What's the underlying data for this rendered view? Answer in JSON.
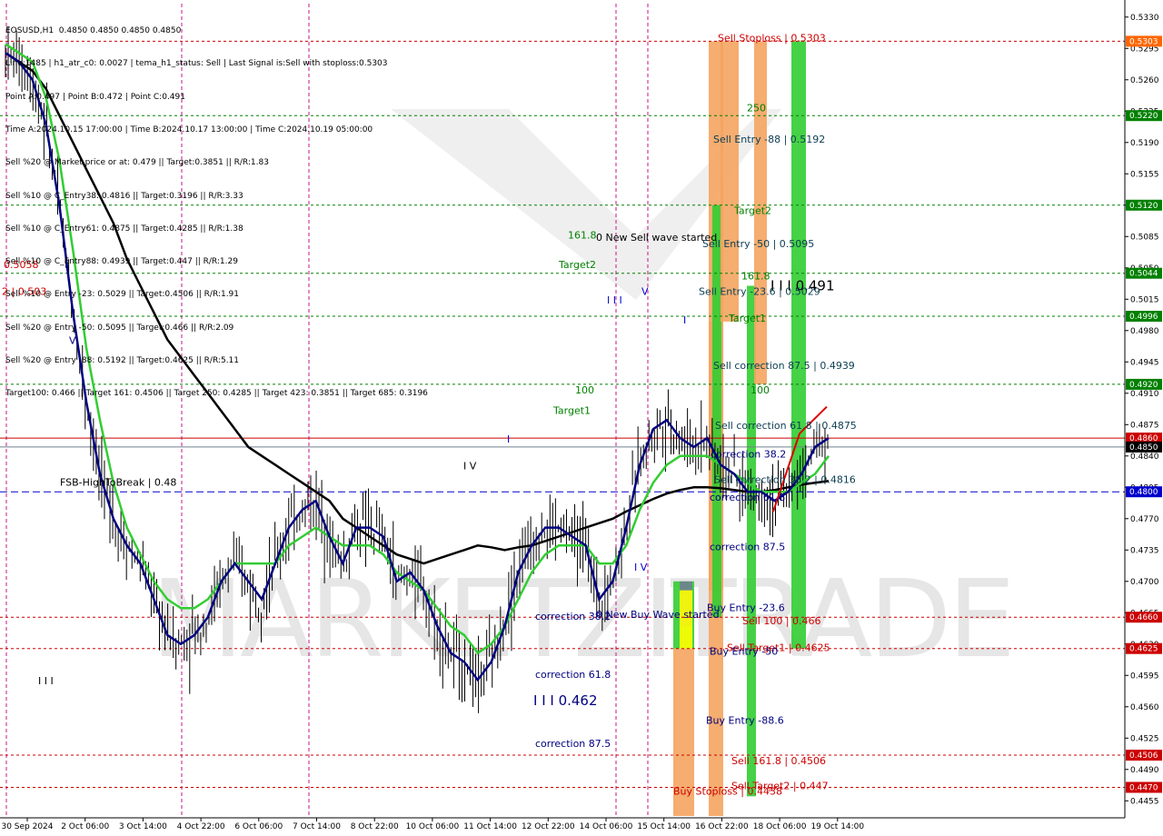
{
  "header": {
    "lines": [
      "EOSUSD,H1  0.4850 0.4850 0.4850 0.4850",
      "Line:1485 | h1_atr_c0: 0.0027 | tema_h1_status: Sell | Last Signal is:Sell with stoploss:0.5303",
      "Point A:0.497 | Point B:0.472 | Point C:0.491",
      "Time A:2024.10.15 17:00:00 | Time B:2024.10.17 13:00:00 | Time C:2024.10.19 05:00:00",
      "Sell %20 @ Market price or at: 0.479 || Target:0.3851 || R/R:1.83",
      "Sell %10 @ C_Entry38: 0.4816 || Target:0.3196 || R/R:3.33",
      "Sell %10 @ C_Entry61: 0.4875 || Target:0.4285 || R/R:1.38",
      "Sell %10 @ C_Entry88: 0.4939 || Target:0.447 || R/R:1.29",
      "Sell %10 @ Entry -23: 0.5029 || Target:0.4506 || R/R:1.91",
      "Sell %20 @ Entry -50: 0.5095 || Target:0.466 || R/R:2.09",
      "Sell %20 @ Entry -88: 0.5192 || Target:0.4625 || R/R:5.11",
      "Target100: 0.466 || Target 161: 0.4506 || Target 250: 0.4285 || Target 423: 0.3851 || Target 685: 0.3196"
    ]
  },
  "colors": {
    "background": "#ffffff",
    "bull_candle": "#000000",
    "bear_candle": "#000000",
    "ema_blue": "#000080",
    "ema_green": "#32cd32",
    "ma_black": "#000000",
    "orange_band": "#ff6600",
    "level_red": "#cc0000",
    "level_green": "#008000",
    "level_blue": "#0000cc",
    "bar_orange": "#f4a460",
    "bar_green": "#32cd32",
    "bar_yellow": "#ffff00",
    "bar_gray": "#708090",
    "watermark": "#e6e6e6"
  },
  "chart_data": {
    "type": "candlestick",
    "symbol": "EOSUSD",
    "timeframe": "H1",
    "ylim": [
      0.4436,
      0.5345
    ],
    "y_ticks": [
      "0.5330",
      "0.5295",
      "0.5260",
      "0.5225",
      "0.5190",
      "0.5155",
      "0.5120",
      "0.5085",
      "0.5050",
      "0.5015",
      "0.4980",
      "0.4945",
      "0.4910",
      "0.4875",
      "0.4840",
      "0.4805",
      "0.4770",
      "0.4735",
      "0.4700",
      "0.4665",
      "0.4630",
      "0.4595",
      "0.4560",
      "0.4525",
      "0.4490",
      "0.4455"
    ],
    "x_ticks": [
      "30 Sep 2024",
      "2 Oct 06:00",
      "3 Oct 14:00",
      "4 Oct 22:00",
      "6 Oct 06:00",
      "7 Oct 14:00",
      "8 Oct 22:00",
      "10 Oct 06:00",
      "11 Oct 14:00",
      "12 Oct 22:00",
      "14 Oct 06:00",
      "15 Oct 14:00",
      "16 Oct 22:00",
      "18 Oct 06:00",
      "19 Oct 14:00"
    ],
    "price_tags": [
      {
        "value": 0.5303,
        "label": "0.5303",
        "color": "#ff6600"
      },
      {
        "value": 0.522,
        "label": "0.5220",
        "color": "#008000"
      },
      {
        "value": 0.512,
        "label": "0.5120",
        "color": "#008000"
      },
      {
        "value": 0.5044,
        "label": "0.5044",
        "color": "#008000"
      },
      {
        "value": 0.4996,
        "label": "0.4996",
        "color": "#008000"
      },
      {
        "value": 0.492,
        "label": "0.4920",
        "color": "#008000"
      },
      {
        "value": 0.486,
        "label": "0.4860",
        "color": "#cc0000"
      },
      {
        "value": 0.485,
        "label": "0.4850",
        "color": "#000000"
      },
      {
        "value": 0.48,
        "label": "0.4800",
        "color": "#0000cc"
      },
      {
        "value": 0.466,
        "label": "0.4660",
        "color": "#cc0000"
      },
      {
        "value": 0.4625,
        "label": "0.4625",
        "color": "#cc0000"
      },
      {
        "value": 0.4506,
        "label": "0.4506",
        "color": "#cc0000"
      },
      {
        "value": 0.447,
        "label": "0.4470",
        "color": "#cc0000"
      }
    ],
    "ema_fast": [
      0.529,
      0.528,
      0.526,
      0.521,
      0.512,
      0.5,
      0.49,
      0.482,
      0.477,
      0.474,
      0.472,
      0.468,
      0.464,
      0.463,
      0.464,
      0.466,
      0.47,
      0.472,
      0.47,
      0.468,
      0.472,
      0.476,
      0.478,
      0.479,
      0.475,
      0.472,
      0.476,
      0.476,
      0.475,
      0.47,
      0.471,
      0.469,
      0.465,
      0.462,
      0.461,
      0.459,
      0.461,
      0.465,
      0.471,
      0.474,
      0.476,
      0.476,
      0.475,
      0.474,
      0.468,
      0.47,
      0.476,
      0.483,
      0.487,
      0.488,
      0.486,
      0.485,
      0.486,
      0.483,
      0.482,
      0.48,
      0.48,
      0.479,
      0.48,
      0.482,
      0.485,
      0.486
    ],
    "ema_slow": [
      0.53,
      0.529,
      0.528,
      0.524,
      0.517,
      0.507,
      0.496,
      0.488,
      0.481,
      0.476,
      0.473,
      0.47,
      0.468,
      0.467,
      0.467,
      0.468,
      0.47,
      0.472,
      0.472,
      0.472,
      0.472,
      0.474,
      0.475,
      0.476,
      0.475,
      0.474,
      0.474,
      0.474,
      0.473,
      0.471,
      0.47,
      0.469,
      0.467,
      0.465,
      0.464,
      0.462,
      0.463,
      0.465,
      0.468,
      0.471,
      0.473,
      0.474,
      0.474,
      0.474,
      0.472,
      0.472,
      0.474,
      0.478,
      0.481,
      0.483,
      0.484,
      0.484,
      0.484,
      0.483,
      0.482,
      0.481,
      0.48,
      0.48,
      0.48,
      0.481,
      0.482,
      0.484
    ],
    "ma_long": [
      0.529,
      0.528,
      0.527,
      0.525,
      0.522,
      0.519,
      0.516,
      0.513,
      0.51,
      0.506,
      0.503,
      0.5,
      0.497,
      0.495,
      0.493,
      0.491,
      0.489,
      0.487,
      0.485,
      0.484,
      0.483,
      0.482,
      0.481,
      0.48,
      0.479,
      0.477,
      0.476,
      0.475,
      0.474,
      0.473,
      0.4725,
      0.472,
      0.4725,
      0.473,
      0.4735,
      0.474,
      0.4738,
      0.4735,
      0.4738,
      0.474,
      0.4745,
      0.475,
      0.4755,
      0.476,
      0.4765,
      0.477,
      0.4778,
      0.4785,
      0.4792,
      0.4798,
      0.4802,
      0.4805,
      0.4805,
      0.4804,
      0.4802,
      0.48,
      0.48,
      0.4802,
      0.4805,
      0.4808,
      0.481,
      0.4812
    ],
    "fib_lines": [
      {
        "value": 0.5303,
        "color": "#cc0000",
        "style": "dashed"
      },
      {
        "value": 0.522,
        "color": "#008000",
        "style": "dashed"
      },
      {
        "value": 0.512,
        "color": "#008000",
        "style": "dashed"
      },
      {
        "value": 0.5044,
        "color": "#008000",
        "style": "dashed"
      },
      {
        "value": 0.4996,
        "color": "#008000",
        "style": "dashed"
      },
      {
        "value": 0.492,
        "color": "#008000",
        "style": "dashed"
      },
      {
        "value": 0.486,
        "color": "#cc0000",
        "style": "solid"
      },
      {
        "value": 0.485,
        "color": "#708090",
        "style": "solid"
      },
      {
        "value": 0.48,
        "color": "#0000cc",
        "style": "dashed"
      },
      {
        "value": 0.466,
        "color": "#cc0000",
        "style": "dashed"
      },
      {
        "value": 0.4625,
        "color": "#cc0000",
        "style": "dashed"
      },
      {
        "value": 0.4506,
        "color": "#cc0000",
        "style": "dashed"
      },
      {
        "value": 0.447,
        "color": "#cc0000",
        "style": "dashed"
      }
    ],
    "vlines": [
      {
        "x": 7,
        "color": "#c71585"
      },
      {
        "x": 200,
        "color": "#c71585"
      },
      {
        "x": 340,
        "color": "#c71585"
      },
      {
        "x": 678,
        "color": "#c71585"
      },
      {
        "x": 713,
        "color": "#c71585"
      }
    ],
    "bars": [
      {
        "col": 0,
        "low": 0.4438,
        "high": 0.4625,
        "color": "#f4a460"
      },
      {
        "col": 0,
        "low": 0.4625,
        "high": 0.47,
        "color": "#32cd32"
      },
      {
        "col": 1,
        "low": 0.465,
        "high": 0.47,
        "color": "#708090"
      },
      {
        "col": 1,
        "low": 0.4625,
        "high": 0.469,
        "color": "#ffff00"
      },
      {
        "col": 2,
        "low": 0.4438,
        "high": 0.499,
        "color": "#f4a460"
      },
      {
        "col": 2,
        "low": 0.469,
        "high": 0.5303,
        "color": "#f4a460"
      },
      {
        "col": 3,
        "low": 0.466,
        "high": 0.512,
        "color": "#32cd32"
      },
      {
        "col": 4,
        "low": 0.499,
        "high": 0.5303,
        "color": "#f4a460"
      },
      {
        "col": 5,
        "low": 0.446,
        "high": 0.503,
        "color": "#32cd32"
      },
      {
        "col": 6,
        "low": 0.492,
        "high": 0.5303,
        "color": "#f4a460"
      },
      {
        "col": 7,
        "low": 0.4625,
        "high": 0.5303,
        "color": "#32cd32"
      }
    ],
    "annotations": [
      {
        "text": "Sell Stoploss | 0.5303",
        "value": 0.5303,
        "anchor": "x790",
        "color": "#cc0000"
      },
      {
        "text": "250",
        "value": 0.5225,
        "anchor": "x822",
        "color": "#008000"
      },
      {
        "text": "Sell Entry -88 | 0.5192",
        "value": 0.519,
        "anchor": "x785",
        "color": "#0b3d52"
      },
      {
        "text": "Target2",
        "value": 0.511,
        "anchor": "x808",
        "color": "#008000"
      },
      {
        "text": "161.8",
        "value": 0.5083,
        "anchor": "x625",
        "color": "#008000"
      },
      {
        "text": "0 New Sell wave started",
        "value": 0.508,
        "anchor": "x656",
        "color": "#000000"
      },
      {
        "text": "Sell Entry -50 | 0.5095",
        "value": 0.5073,
        "anchor": "x773",
        "color": "#0b3d52"
      },
      {
        "text": "Target2",
        "value": 0.505,
        "anchor": "x615",
        "color": "#008000"
      },
      {
        "text": "161.8",
        "value": 0.5037,
        "anchor": "x816",
        "color": "#008000"
      },
      {
        "text": "I I I 0.491",
        "value": 0.5025,
        "anchor": "x848",
        "color": "#000000"
      },
      {
        "text": "Sell Entry -23.6 | 0.5029",
        "value": 0.502,
        "anchor": "x769",
        "color": "#0b3d52"
      },
      {
        "text": "I I I",
        "value": 0.501,
        "anchor": "x668",
        "color": "#0000cc"
      },
      {
        "text": "V",
        "value": 0.502,
        "anchor": "x706",
        "color": "#0000cc"
      },
      {
        "text": "Target1",
        "value": 0.499,
        "anchor": "x802",
        "color": "#008000"
      },
      {
        "text": "I",
        "value": 0.4988,
        "anchor": "x752",
        "color": "#0000cc"
      },
      {
        "text": "V",
        "value": 0.4965,
        "anchor": "x76",
        "color": "#000080"
      },
      {
        "text": "Sell correction 87.5 | 0.4939",
        "value": 0.4937,
        "anchor": "x785",
        "color": "#0b3d52"
      },
      {
        "text": "100",
        "value": 0.491,
        "anchor": "x633",
        "color": "#008000"
      },
      {
        "text": "100",
        "value": 0.491,
        "anchor": "x826",
        "color": "#008000"
      },
      {
        "text": "Target1",
        "value": 0.4887,
        "anchor": "x609",
        "color": "#008000"
      },
      {
        "text": "Sell correction 61.8 | 0.4875",
        "value": 0.487,
        "anchor": "x787",
        "color": "#0b3d52"
      },
      {
        "text": "I",
        "value": 0.4855,
        "anchor": "x558",
        "color": "#0000cc"
      },
      {
        "text": "correction 38.2",
        "value": 0.4838,
        "anchor": "x782",
        "color": "#000080"
      },
      {
        "text": "I V",
        "value": 0.4825,
        "anchor": "x510",
        "color": "#000000"
      },
      {
        "text": "FSB-HighToBreak | 0.48",
        "value": 0.4807,
        "anchor": "x66",
        "color": "#000000"
      },
      {
        "text": "Sell correction 38.2 | 0.4816",
        "value": 0.481,
        "anchor": "x786",
        "color": "#0b3d52"
      },
      {
        "text": "correction 61.8",
        "value": 0.479,
        "anchor": "x781",
        "color": "#000080"
      },
      {
        "text": "correction 87.5",
        "value": 0.4735,
        "anchor": "x781",
        "color": "#000080"
      },
      {
        "text": "I V",
        "value": 0.4712,
        "anchor": "x698",
        "color": "#0000cc"
      },
      {
        "text": "Buy Entry -23.6",
        "value": 0.4667,
        "anchor": "x778",
        "color": "#000080"
      },
      {
        "text": "correction 38.2",
        "value": 0.4657,
        "anchor": "x589",
        "color": "#000080"
      },
      {
        "text": "0 New Buy Wave started",
        "value": 0.4659,
        "anchor": "x656",
        "color": "#000080"
      },
      {
        "text": "Sell 100 | 0.466",
        "value": 0.4652,
        "anchor": "x817",
        "color": "#cc0000"
      },
      {
        "text": "Sell Target1 | 0.4625",
        "value": 0.4622,
        "anchor": "x800",
        "color": "#cc0000"
      },
      {
        "text": "Buy Entry -50",
        "value": 0.4618,
        "anchor": "x781",
        "color": "#000080"
      },
      {
        "text": "correction 61.8",
        "value": 0.4592,
        "anchor": "x589",
        "color": "#000080"
      },
      {
        "text": "I I I 0.462",
        "value": 0.4562,
        "anchor": "x587",
        "color": "#000080"
      },
      {
        "text": "Buy Entry -88.6",
        "value": 0.4541,
        "anchor": "x777",
        "color": "#000080"
      },
      {
        "text": "correction 87.5",
        "value": 0.4515,
        "anchor": "x589",
        "color": "#000080"
      },
      {
        "text": "Sell 161.8 | 0.4506",
        "value": 0.4496,
        "anchor": "x805",
        "color": "#cc0000"
      },
      {
        "text": "Sell Target2 | 0.447",
        "value": 0.4468,
        "anchor": "x805",
        "color": "#cc0000"
      },
      {
        "text": "Buy Stoploss | 0.4438",
        "value": 0.4462,
        "anchor": "x741",
        "color": "#cc0000"
      },
      {
        "text": "0.5058",
        "value": 0.505,
        "anchor": "x4",
        "color": "#cc0000"
      },
      {
        "text": "2 | 0.503",
        "value": 0.502,
        "anchor": "x2",
        "color": "#cc0000"
      },
      {
        "text": "I I I",
        "value": 0.4585,
        "anchor": "x42",
        "color": "#000000"
      }
    ],
    "watermark": "MARKETZITRADE"
  }
}
